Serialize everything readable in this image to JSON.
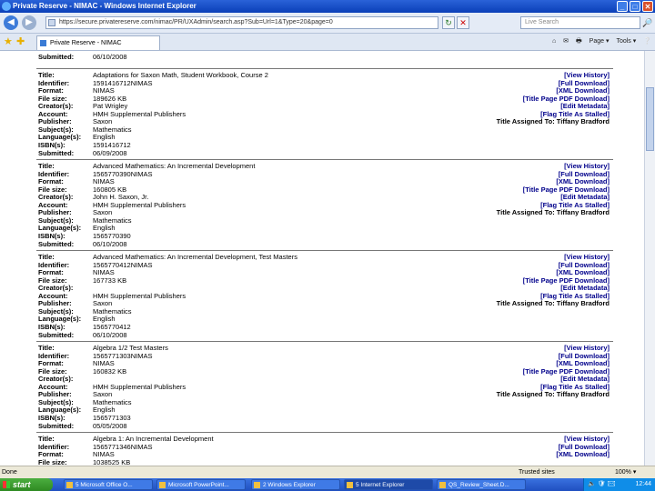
{
  "window": {
    "title": "Private Reserve - NIMAC - Windows Internet Explorer",
    "buttons": [
      "_",
      "□",
      "✕"
    ]
  },
  "address_bar": {
    "url": "https://secure.privatereserve.com/nimac/PR/UXAdmin/search.asp?Sub=Url=1&Type=20&page=0",
    "search_placeholder": "Live Search",
    "search_go": "🔎"
  },
  "tab": {
    "label": "Private Reserve - NIMAC"
  },
  "command_bar": [
    "⌂",
    "✉",
    "🖶",
    "Page ▾",
    "Tools ▾",
    "❔"
  ],
  "records": [
    {
      "fields": [
        {
          "label": "Submitted:",
          "value": "06/10/2008"
        }
      ],
      "actions": []
    },
    {
      "fields": [
        {
          "label": "Title:",
          "value": "Adaptations for Saxon Math, Student Workbook, Course 2"
        },
        {
          "label": "Identifier:",
          "value": "1591416712NIMAS"
        },
        {
          "label": "Format:",
          "value": "NIMAS"
        },
        {
          "label": "File size:",
          "value": "189626 KB"
        },
        {
          "label": "Creator(s):",
          "value": "Pat Wrigley"
        },
        {
          "label": "Account:",
          "value": "HMH Supplemental Publishers"
        },
        {
          "label": "Publisher:",
          "value": "Saxon"
        },
        {
          "label": "Subject(s):",
          "value": "Mathematics"
        },
        {
          "label": "Language(s):",
          "value": "English"
        },
        {
          "label": "ISBN(s):",
          "value": "1591416712"
        },
        {
          "label": "Submitted:",
          "value": "06/09/2008"
        }
      ],
      "actions": [
        "[View History]",
        "[Full Download]",
        "[XML Download]",
        "[Title Page PDF Download]",
        "[Edit Metadata]",
        "[Flag Title As Stalled]",
        "Title Assigned To: Tiffany Bradford"
      ]
    },
    {
      "fields": [
        {
          "label": "Title:",
          "value": "Advanced Mathematics: An Incremental Development"
        },
        {
          "label": "Identifier:",
          "value": "1565770390NIMAS"
        },
        {
          "label": "Format:",
          "value": "NIMAS"
        },
        {
          "label": "File size:",
          "value": "160805 KB"
        },
        {
          "label": "Creator(s):",
          "value": "John H. Saxon, Jr."
        },
        {
          "label": "Account:",
          "value": "HMH Supplemental Publishers"
        },
        {
          "label": "Publisher:",
          "value": "Saxon"
        },
        {
          "label": "Subject(s):",
          "value": "Mathematics"
        },
        {
          "label": "Language(s):",
          "value": "English"
        },
        {
          "label": "ISBN(s):",
          "value": "1565770390"
        },
        {
          "label": "Submitted:",
          "value": "06/10/2008"
        }
      ],
      "actions": [
        "[View History]",
        "[Full Download]",
        "[XML Download]",
        "[Title Page PDF Download]",
        "[Edit Metadata]",
        "[Flag Title As Stalled]",
        "Title Assigned To: Tiffany Bradford"
      ]
    },
    {
      "fields": [
        {
          "label": "Title:",
          "value": "Advanced Mathematics: An Incremental Development, Test Masters"
        },
        {
          "label": "Identifier:",
          "value": "1565770412NIMAS"
        },
        {
          "label": "Format:",
          "value": "NIMAS"
        },
        {
          "label": "File size:",
          "value": "167733 KB"
        },
        {
          "label": "Creator(s):",
          "value": ""
        },
        {
          "label": "Account:",
          "value": "HMH Supplemental Publishers"
        },
        {
          "label": "Publisher:",
          "value": "Saxon"
        },
        {
          "label": "Subject(s):",
          "value": "Mathematics"
        },
        {
          "label": "Language(s):",
          "value": "English"
        },
        {
          "label": "ISBN(s):",
          "value": "1565770412"
        },
        {
          "label": "Submitted:",
          "value": "06/10/2008"
        }
      ],
      "actions": [
        "[View History]",
        "[Full Download]",
        "[XML Download]",
        "[Title Page PDF Download]",
        "[Edit Metadata]",
        "[Flag Title As Stalled]",
        "Title Assigned To: Tiffany Bradford"
      ]
    },
    {
      "fields": [
        {
          "label": "Title:",
          "value": "Algebra 1/2 Test Masters"
        },
        {
          "label": "Identifier:",
          "value": "1565771303NIMAS"
        },
        {
          "label": "Format:",
          "value": "NIMAS"
        },
        {
          "label": "File size:",
          "value": "160832 KB"
        },
        {
          "label": "Creator(s):",
          "value": ""
        },
        {
          "label": "Account:",
          "value": "HMH Supplemental Publishers"
        },
        {
          "label": "Publisher:",
          "value": "Saxon"
        },
        {
          "label": "Subject(s):",
          "value": "Mathematics"
        },
        {
          "label": "Language(s):",
          "value": "English"
        },
        {
          "label": "ISBN(s):",
          "value": "1565771303"
        },
        {
          "label": "Submitted:",
          "value": "05/05/2008"
        }
      ],
      "actions": [
        "[View History]",
        "[Full Download]",
        "[XML Download]",
        "[Title Page PDF Download]",
        "[Edit Metadata]",
        "[Flag Title As Stalled]",
        "Title Assigned To: Tiffany Bradford"
      ]
    },
    {
      "fields": [
        {
          "label": "Title:",
          "value": "Algebra 1: An Incremental Development"
        },
        {
          "label": "Identifier:",
          "value": "1565771346NIMAS"
        },
        {
          "label": "Format:",
          "value": "NIMAS"
        },
        {
          "label": "File size:",
          "value": "1038525 KB"
        }
      ],
      "actions": [
        "[View History]",
        "[Full Download]",
        "[XML Download]"
      ]
    }
  ],
  "status_bar": {
    "left": "Done",
    "zone": "Trusted sites",
    "zoom": "100% ▾"
  },
  "taskbar": {
    "start_label": "start",
    "items": [
      {
        "label": "5 Microsoft Office O..."
      },
      {
        "label": "Microsoft PowerPoint..."
      },
      {
        "label": "2 Windows Explorer"
      },
      {
        "label": "5 Internet Explorer"
      },
      {
        "label": "QS_Review_Sheet.D..."
      }
    ],
    "tray_icons": "🔈🛡✉",
    "clock": "12:44"
  },
  "colors": {
    "link": "#00008b",
    "titlebar": "#0a3fb8",
    "taskbar": "#1f4fc0",
    "start": "#2e8a22"
  }
}
